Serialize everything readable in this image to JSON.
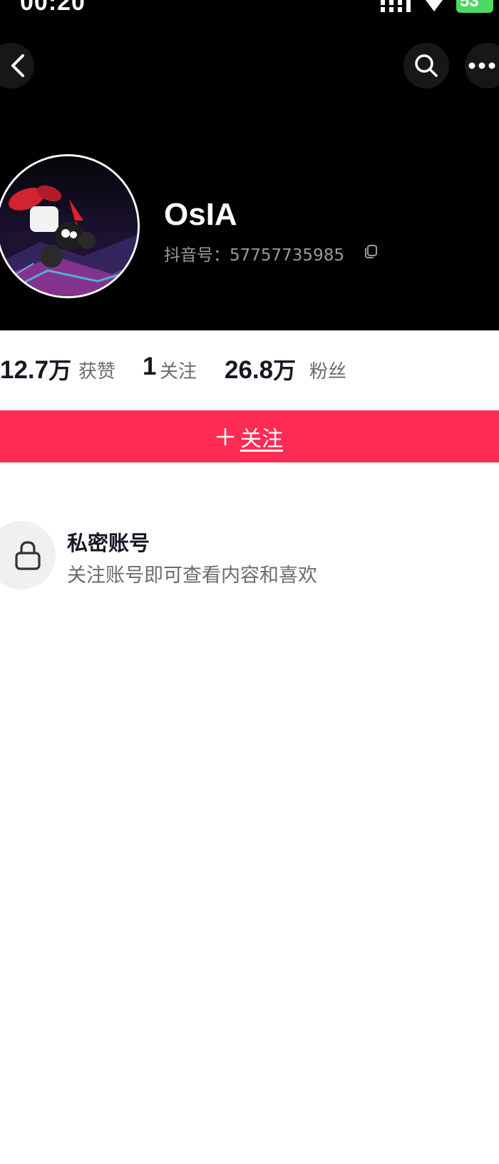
{
  "status_bar": {
    "time": "00:20",
    "battery": "53"
  },
  "nav": {
    "back_icon": "chevron-left-icon",
    "search_icon": "search-icon",
    "more_icon": "more-horizontal-icon"
  },
  "profile": {
    "username": "OsIA",
    "account_id": "抖音号：57757735985",
    "copy_icon": "copy-icon"
  },
  "stats": {
    "likes_value": "12.7",
    "likes_unit": "万",
    "likes_label": "获赞",
    "following_value": "1",
    "following_label": "关注",
    "followers_value": "26.8",
    "followers_unit": "万",
    "followers_label": "粉丝"
  },
  "follow_button": {
    "label": "关注",
    "icon": "plus-icon",
    "color": "#fe2c55"
  },
  "private_notice": {
    "title": "私密账号",
    "description": "关注账号即可查看内容和喜欢",
    "icon": "lock-icon"
  },
  "colors": {
    "header_bg": "#000000",
    "accent": "#fe2c55",
    "battery": "#4cd964"
  }
}
